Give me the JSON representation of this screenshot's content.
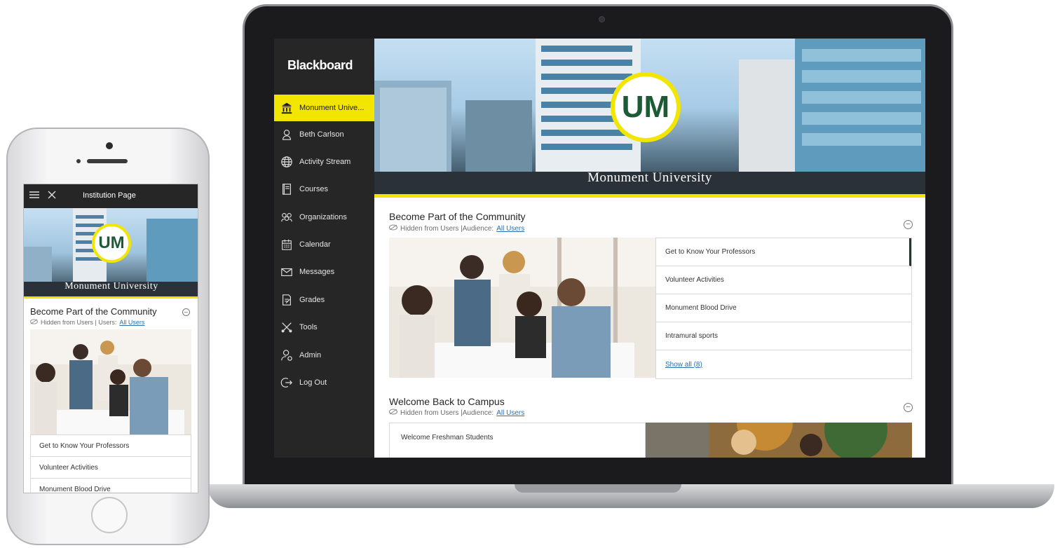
{
  "laptop": {
    "brand": "Blackboard",
    "nav": [
      {
        "label": "Monument Unive...",
        "icon": "institution-icon",
        "active": true
      },
      {
        "label": "Beth Carlson",
        "icon": "user-icon"
      },
      {
        "label": "Activity Stream",
        "icon": "globe-icon"
      },
      {
        "label": "Courses",
        "icon": "courses-icon"
      },
      {
        "label": "Organizations",
        "icon": "organizations-icon"
      },
      {
        "label": "Calendar",
        "icon": "calendar-icon"
      },
      {
        "label": "Messages",
        "icon": "envelope-icon"
      },
      {
        "label": "Grades",
        "icon": "grades-icon"
      },
      {
        "label": "Tools",
        "icon": "tools-icon"
      },
      {
        "label": "Admin",
        "icon": "admin-icon"
      },
      {
        "label": "Log Out",
        "icon": "logout-icon"
      }
    ],
    "banner": {
      "logo_text": "UM",
      "title": "Monument University"
    },
    "section1": {
      "title": "Become Part of the Community",
      "hidden_text": "Hidden from Users |Audience:",
      "audience_link": "All Users",
      "items": [
        "Get to Know Your Professors",
        "Volunteer Activities",
        "Monument Blood Drive",
        "Intramural sports"
      ],
      "show_all": "Show all (8)"
    },
    "section2": {
      "title": "Welcome Back to Campus",
      "hidden_text": "Hidden from Users |Audience:",
      "audience_link": "All Users",
      "items": [
        "Welcome Freshman Students"
      ]
    }
  },
  "phone": {
    "header_title": "Institution Page",
    "banner": {
      "logo_text": "UM",
      "title": "Monument University"
    },
    "section": {
      "title": "Become Part of the Community",
      "hidden_text": "Hidden from Users | Users:",
      "audience_link": "All Users",
      "items": [
        "Get to Know Your Professors",
        "Volunteer Activities",
        "Monument Blood Drive"
      ]
    }
  },
  "colors": {
    "accent_yellow": "#f2e500",
    "sidebar": "#262626",
    "logo_green": "#1d5b36",
    "link": "#2a6fb0"
  }
}
